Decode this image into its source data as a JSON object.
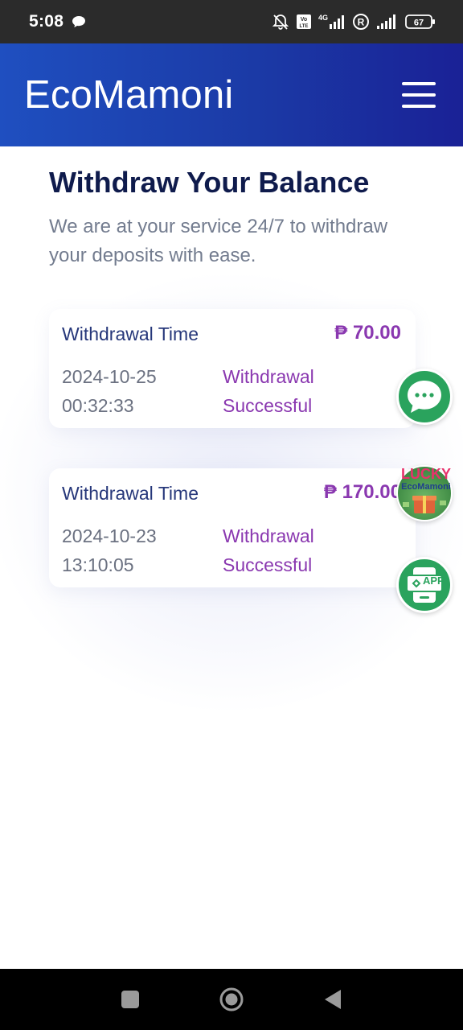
{
  "status_bar": {
    "time": "5:08",
    "icons": [
      "chat-bubble-icon",
      "bell-off-icon",
      "volte-icon",
      "signal-4g-icon",
      "registered-icon",
      "signal-icon",
      "battery-icon"
    ],
    "volte_text": "Vo LTE",
    "network": "4G",
    "registered": "R",
    "battery_level": "67"
  },
  "header": {
    "brand": "EcoMamoni",
    "menu_icon": "hamburger-menu-icon"
  },
  "main": {
    "title": "Withdraw Your Balance",
    "subtitle": "We are at your service 24/7 to withdraw your deposits with ease.",
    "withdrawals": [
      {
        "label": "Withdrawal Time",
        "amount": "₱ 70.00",
        "date": "2024-10-25",
        "time": "00:32:33",
        "status_line1": "Withdrawal",
        "status_line2": "Successful"
      },
      {
        "label": "Withdrawal Time",
        "amount": "₱ 170.00",
        "date": "2024-10-23",
        "time": "13:10:05",
        "status_line1": "Withdrawal",
        "status_line2": "Successful"
      }
    ]
  },
  "floating": {
    "chat_icon": "chat-support-icon",
    "lucky_line1": "LUCKY",
    "lucky_line2": "EcoMamoni",
    "app_label": "APP"
  },
  "nav": {
    "icons": [
      "recents-square-icon",
      "home-circle-icon",
      "back-triangle-icon"
    ]
  },
  "colors": {
    "header_start": "#1f4fc0",
    "header_end": "#1a2196",
    "title": "#0f1b4c",
    "accent_purple": "#8a38b0",
    "fab_green": "#2aa35d"
  }
}
